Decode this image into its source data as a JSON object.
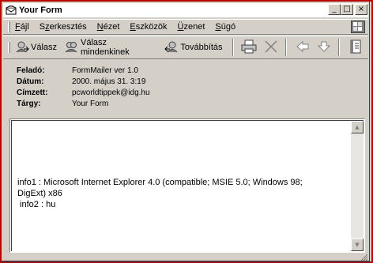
{
  "window": {
    "title": "Your Form"
  },
  "menu": [
    {
      "label": "Fájl",
      "accel": "F"
    },
    {
      "label": "Szerkesztés",
      "accel": "z"
    },
    {
      "label": "Nézet",
      "accel": "N"
    },
    {
      "label": "Eszközök",
      "accel": "E"
    },
    {
      "label": "Üzenet",
      "accel": "Ü"
    },
    {
      "label": "Súgó",
      "accel": "S"
    }
  ],
  "toolbar": {
    "reply_label": "Válasz",
    "reply_all_label": "Válasz mindenkinek",
    "forward_label": "Továbbítás"
  },
  "headers": {
    "from_label": "Feladó:",
    "from_value": "FormMailer ver 1.0",
    "date_label": "Dátum:",
    "date_value": "2000. május 31. 3:19",
    "to_label": "Címzett:",
    "to_value": "pcworldtippek@idg.hu",
    "subject_label": "Tárgy:",
    "subject_value": "Your Form"
  },
  "message": {
    "line1": "info1 : Microsoft Internet Explorer 4.0 (compatible; MSIE 5.0; Windows 98;",
    "line2": "DigExt) x86",
    "line3": " info2 : hu"
  },
  "colors": {
    "frame_border": "#c00000",
    "chrome": "#d4d0c8",
    "pane": "#ffffff"
  },
  "icons": [
    "mail-icon",
    "minimize-icon",
    "maximize-icon",
    "close-icon",
    "windows-logo-icon",
    "reply-icon",
    "reply-all-icon",
    "forward-icon",
    "print-icon",
    "delete-icon",
    "previous-icon",
    "next-icon",
    "address-book-icon",
    "scroll-up-icon",
    "scroll-down-icon",
    "resize-grip-icon"
  ]
}
